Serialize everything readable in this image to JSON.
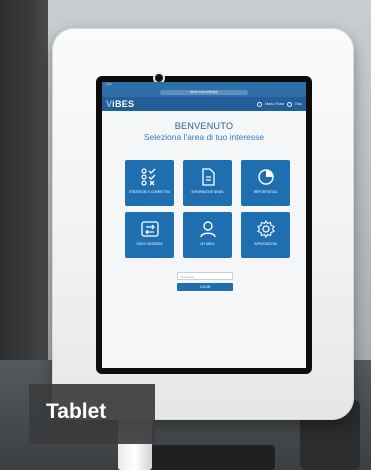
{
  "browser": {
    "status_text": "9:41",
    "url": "vibes.example/app"
  },
  "app": {
    "logo_prefix": "V",
    "logo_rest": "iBES",
    "user_name": "Mario Rossi",
    "exit_label": "Esci"
  },
  "welcome": {
    "title": "BENVENUTO",
    "subtitle": "Seleziona l'area di tuo interesse"
  },
  "tiles": [
    {
      "label": "STRATEGIE E CORRETTIVI",
      "icon": "checklist-icon"
    },
    {
      "label": "INFORMATIVE NEWS",
      "icon": "document-icon"
    },
    {
      "label": "REPORTISTICA",
      "icon": "pie-chart-icon"
    },
    {
      "label": "FASI E SESSIONI",
      "icon": "swap-icon"
    },
    {
      "label": "MY AREA",
      "icon": "user-icon"
    },
    {
      "label": "IMPOSTAZIONI",
      "icon": "gear-icon"
    }
  ],
  "login": {
    "placeholder": "Password",
    "button": "LOGIN"
  },
  "caption": "Tablet",
  "colors": {
    "primary": "#1f6fb0",
    "header": "#225f99",
    "enclosure": "#f4f4f4"
  }
}
